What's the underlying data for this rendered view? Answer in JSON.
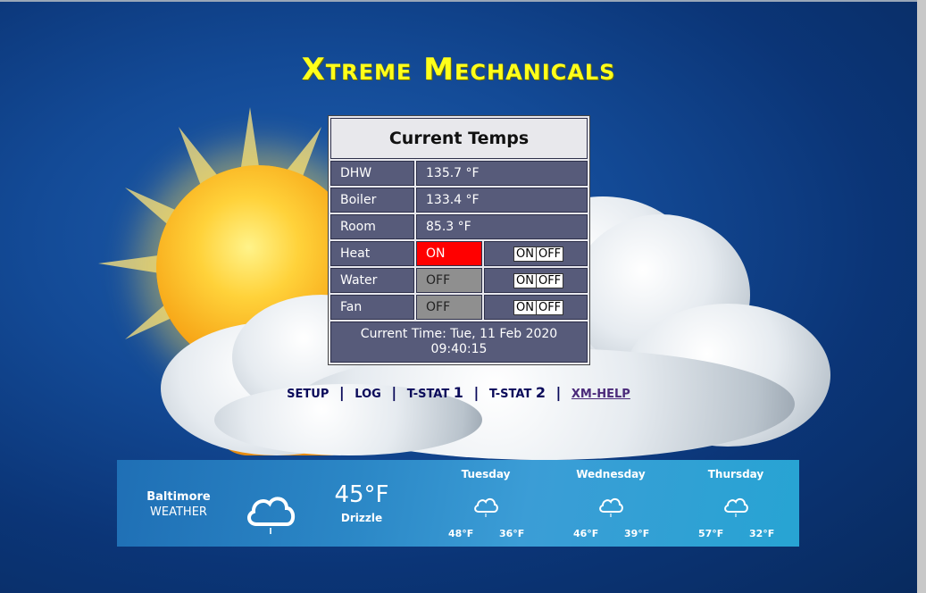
{
  "title": "Xtreme Mechanicals",
  "temps": {
    "heading": "Current Temps",
    "rows": [
      {
        "label": "DHW",
        "value": "135.7 °F"
      },
      {
        "label": "Boiler",
        "value": "133.4 °F"
      },
      {
        "label": "Room",
        "value": "85.3 °F"
      }
    ],
    "controls": [
      {
        "label": "Heat",
        "state": "ON",
        "on_label": "ON",
        "off_label": "OFF"
      },
      {
        "label": "Water",
        "state": "OFF",
        "on_label": "ON",
        "off_label": "OFF"
      },
      {
        "label": "Fan",
        "state": "OFF",
        "on_label": "ON",
        "off_label": "OFF"
      }
    ],
    "time_line1": "Current Time: Tue, 11 Feb 2020",
    "time_line2": "09:40:15"
  },
  "nav": {
    "setup": "SETUP",
    "log": "LOG",
    "tstat1_label": "T-STAT",
    "tstat1_num": "1",
    "tstat2_label": "T-STAT",
    "tstat2_num": "2",
    "help": "XM-HELP",
    "separator": "|"
  },
  "weather": {
    "city": "Baltimore",
    "label": "WEATHER",
    "current_temp": "45°F",
    "condition": "Drizzle",
    "icons": {
      "current": "cloud-drizzle-icon",
      "forecast": "cloud-drizzle-icon"
    },
    "forecast": [
      {
        "day": "Tuesday",
        "hi": "48°F",
        "lo": "36°F"
      },
      {
        "day": "Wednesday",
        "hi": "46°F",
        "lo": "39°F"
      },
      {
        "day": "Thursday",
        "hi": "57°F",
        "lo": "32°F"
      }
    ]
  },
  "colors": {
    "title": "#ffff1a",
    "on": "#ff0000",
    "off": "#8f8f8f",
    "cell": "#575b7a"
  }
}
